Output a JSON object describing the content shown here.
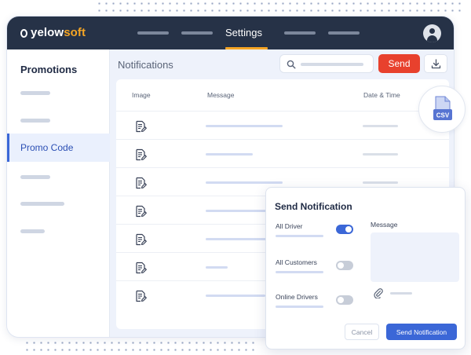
{
  "app": {
    "logo_prefix": "yelow",
    "logo_suffix": "soft",
    "active_nav": "Settings",
    "brand_color": "#f5a524",
    "accent_color": "#3b67d7",
    "danger_color": "#e8412d"
  },
  "sidebar": {
    "title": "Promotions",
    "active_item": "Promo Code"
  },
  "content": {
    "title": "Notifications",
    "send_label": "Send",
    "download_icon": "download-icon",
    "search_icon": "search-icon"
  },
  "table": {
    "columns": [
      "Image",
      "Message",
      "Date & Time"
    ],
    "row_icon": "document-edit-icon",
    "row_count": 7
  },
  "csv_badge": {
    "label": "CSV"
  },
  "modal": {
    "title": "Send Notification",
    "options": [
      {
        "label": "All Driver",
        "enabled": true
      },
      {
        "label": "All Customers",
        "enabled": false
      },
      {
        "label": "Online Drivers",
        "enabled": false
      }
    ],
    "message_label": "Message",
    "attach_icon": "paperclip-icon",
    "cancel_label": "Cancel",
    "submit_label": "Send Notification"
  }
}
